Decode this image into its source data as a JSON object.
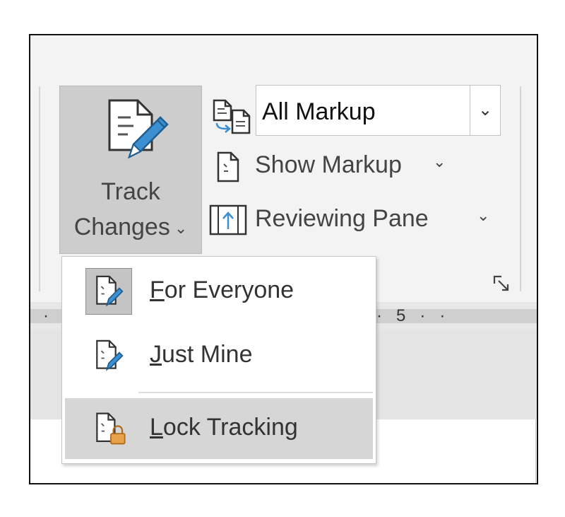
{
  "ribbon": {
    "track_changes": {
      "line1": "Track",
      "line2": "Changes",
      "chevron": "⌄"
    },
    "markup_select": {
      "value": "All Markup",
      "dropdown_glyph": "⌄"
    },
    "show_markup": {
      "label": "Show Markup",
      "chevron": "⌄"
    },
    "reviewing_pane": {
      "label": "Reviewing Pane",
      "chevron": "⌄"
    },
    "dialog_launcher_icon": "dialog-launcher-icon"
  },
  "ruler": {
    "left_dot": "·",
    "right_marks": "·   5   ·   ·"
  },
  "menu": {
    "items": [
      {
        "mnemonic": "F",
        "rest": "or Everyone",
        "icon": "track-changes-pen-icon",
        "active": true
      },
      {
        "mnemonic": "J",
        "rest": "ust Mine",
        "icon": "track-changes-pen-icon",
        "active": false
      },
      {
        "mnemonic": "L",
        "rest": "ock Tracking",
        "icon": "lock-document-icon",
        "hover": true
      }
    ]
  },
  "colors": {
    "pen_blue": "#3c8fd0",
    "lock_orange": "#e8a24a",
    "ribbon_bg": "#f3f3f3",
    "pressed_bg": "#cdcdcd"
  }
}
